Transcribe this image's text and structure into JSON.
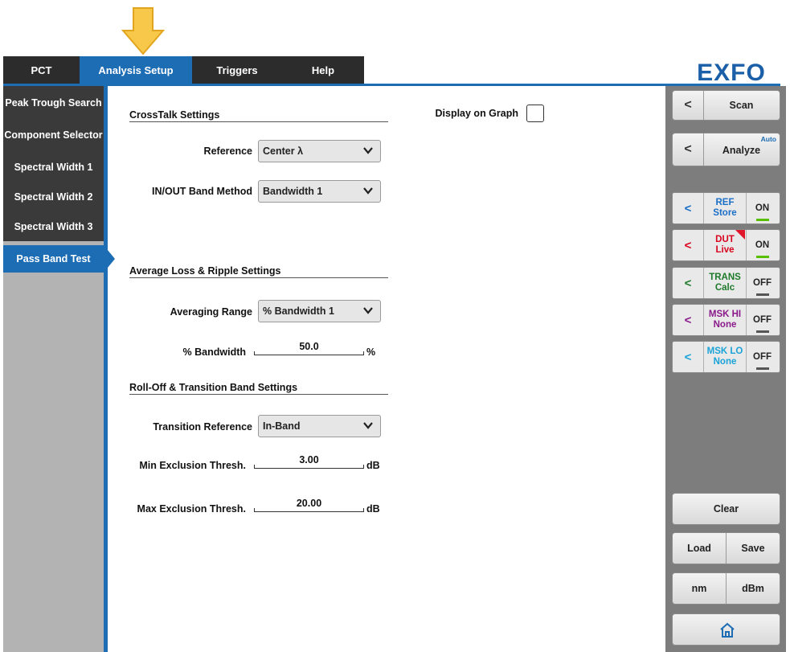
{
  "tabs": [
    {
      "label": "PCT"
    },
    {
      "label": "Analysis Setup"
    },
    {
      "label": "Triggers"
    },
    {
      "label": "Help"
    }
  ],
  "logo_text": "EXFO",
  "sidebar": {
    "items": [
      {
        "label": "Peak Trough Search"
      },
      {
        "label": "Component Selector"
      },
      {
        "label": "Spectral Width 1"
      },
      {
        "label": "Spectral Width 2"
      },
      {
        "label": "Spectral Width 3"
      },
      {
        "label": "Pass Band Test"
      }
    ],
    "active": "Pass Band Test"
  },
  "crosstalk": {
    "title": "CrossTalk Settings",
    "reference_label": "Reference",
    "reference_value": "Center λ",
    "inout_label": "IN/OUT Band Method",
    "inout_value": "Bandwidth 1"
  },
  "display_on_graph": {
    "label": "Display on Graph",
    "checked": false
  },
  "avg_loss": {
    "title": "Average Loss & Ripple Settings",
    "averaging_label": "Averaging Range",
    "averaging_value": "% Bandwidth 1",
    "pct_bw_label": "% Bandwidth",
    "pct_bw_value": "50.0",
    "pct_bw_unit": "%"
  },
  "rolloff": {
    "title": "Roll-Off & Transition Band Settings",
    "transition_label": "Transition Reference",
    "transition_value": "In-Band",
    "min_label": "Min Exclusion Thresh.",
    "min_value": "3.00",
    "min_unit": "dB",
    "max_label": "Max Exclusion Thresh.",
    "max_value": "20.00",
    "max_unit": "dB"
  },
  "right_panel": {
    "scan_label": "Scan",
    "analyze_label": "Analyze",
    "analyze_badge": "Auto",
    "back_glyph": "<",
    "traces": [
      {
        "line1": "REF",
        "line2": "Store",
        "state": "ON",
        "color": "#1b6fc7",
        "indicator": "#58c000"
      },
      {
        "line1": "DUT",
        "line2": "Live",
        "state": "ON",
        "color": "#d8001c",
        "indicator": "#58c000"
      },
      {
        "line1": "TRANS",
        "line2": "Calc",
        "state": "OFF",
        "color": "#1e7a2a",
        "indicator": "#555555"
      },
      {
        "line1": "MSK HI",
        "line2": "None",
        "state": "OFF",
        "color": "#8a1a8a",
        "indicator": "#555555"
      },
      {
        "line1": "MSK LO",
        "line2": "None",
        "state": "OFF",
        "color": "#19a3d8",
        "indicator": "#555555"
      }
    ],
    "clear_label": "Clear",
    "load_label": "Load",
    "save_label": "Save",
    "nm_label": "nm",
    "dbm_label": "dBm",
    "home_icon": "home-icon"
  },
  "colors": {
    "accent": "#1d6db5",
    "pointer": "#f5c242"
  }
}
